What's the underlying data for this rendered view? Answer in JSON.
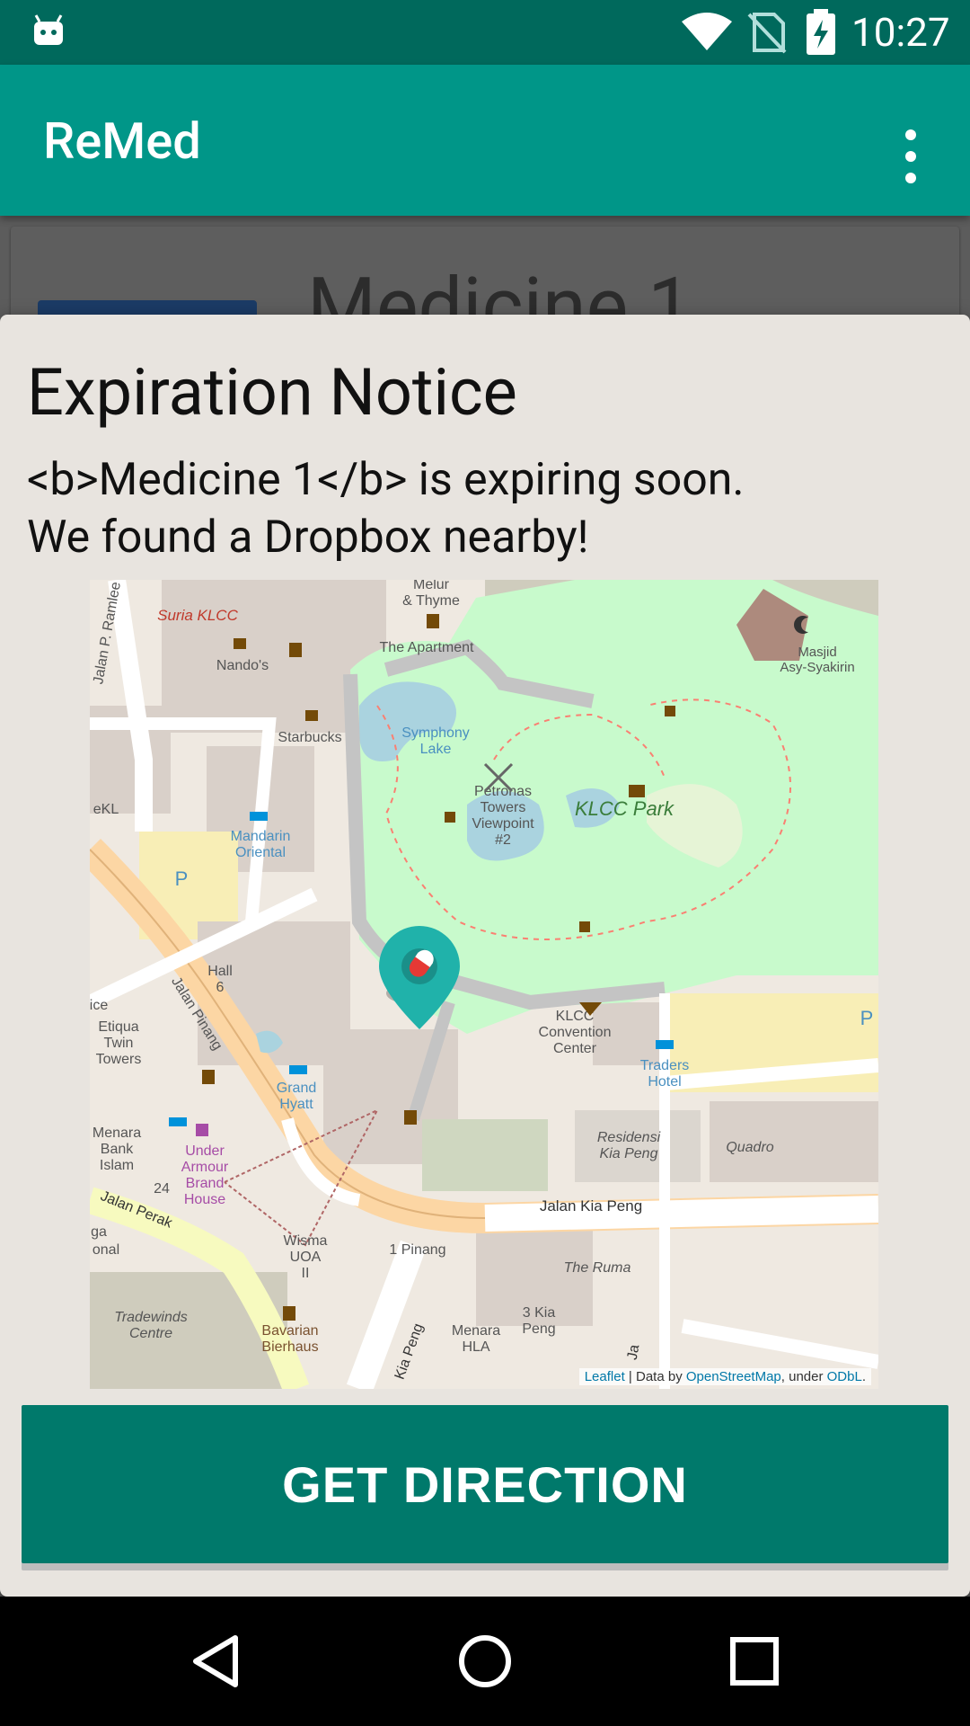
{
  "status_bar": {
    "time": "10:27",
    "icons": [
      "android-icon",
      "wifi-icon",
      "no-sim-icon",
      "battery-charging-icon"
    ]
  },
  "app_bar": {
    "title": "ReMed",
    "menu_icon": "more-vert-icon"
  },
  "background": {
    "card_title": "Medicine 1"
  },
  "dialog": {
    "title": "Expiration Notice",
    "message_line1": "<b>Medicine 1</b> is expiring soon.",
    "message_line2": "We found a Dropbox nearby!",
    "button_label": "GET DIRECTION"
  },
  "map": {
    "marker_icon": "pill-marker-icon",
    "labels": {
      "suria": "Suria KLCC",
      "nandos": "Nando's",
      "melur1": "Melur",
      "melur2": "& Thyme",
      "apartment": "The Apartment",
      "masjid1": "Masjid",
      "masjid2": "Asy-Syakirin",
      "starbucks": "Starbucks",
      "symphony1": "Symphony",
      "symphony2": "Lake",
      "petronas1": "Petronas",
      "petronas2": "Towers",
      "petronas3": "Viewpoint",
      "petronas4": "#2",
      "klcc_park": "KLCC Park",
      "mandarin1": "Mandarin",
      "mandarin2": "Oriental",
      "ekl": "eKL",
      "jalan_ramlee": "Jalan P. Ramlee",
      "hall1": "Hall",
      "hall2": "6",
      "ice": "ice",
      "etiqua1": "Etiqua",
      "etiqua2": "Twin",
      "etiqua3": "Towers",
      "jalan_pinang": "Jalan Pinang",
      "grand1": "Grand",
      "grand2": "Hyatt",
      "klcc_conv1": "KLCC",
      "klcc_conv2": "Convention",
      "klcc_conv3": "Center",
      "traders1": "Traders",
      "traders2": "Hotel",
      "menara_bank1": "Menara",
      "menara_bank2": "Bank",
      "menara_bank3": "Islam",
      "under1": "Under",
      "under2": "Armour",
      "under3": "Brand",
      "under4": "House",
      "residensi1": "Residensi",
      "residensi2": "Kia Peng",
      "quadro": "Quadro",
      "jalan_kia_peng": "Jalan Kia Peng",
      "jalan_perak": "Jalan Perak",
      "num24": "24",
      "ga": "ga",
      "onal": "onal",
      "wisma1": "Wisma",
      "wisma2": "UOA",
      "wisma3": "II",
      "one_pinang": "1 Pinang",
      "the_ruma": "The Ruma",
      "tradewinds1": "Tradewinds",
      "tradewinds2": "Centre",
      "bavarian1": "Bavarian",
      "bavarian2": "Bierhaus",
      "kia_peng_road": "Kia Peng",
      "menara_hla1": "Menara",
      "menara_hla2": "HLA",
      "kia3_1": "3 Kia",
      "kia3_2": "Peng",
      "parking": "P",
      "ja": "Ja"
    },
    "attribution": {
      "leaflet": "Leaflet",
      "sep": " | Data by ",
      "osm": "OpenStreetMap",
      "under": ", under ",
      "odbl": "ODbL",
      "end": "."
    }
  },
  "nav_bar": {
    "back": "back-icon",
    "home": "home-icon",
    "recents": "recents-icon"
  },
  "colors": {
    "status_bar": "#00695c",
    "app_bar": "#009688",
    "button": "#00796b",
    "park": "#c8facc",
    "marker": "#20b2aa"
  }
}
